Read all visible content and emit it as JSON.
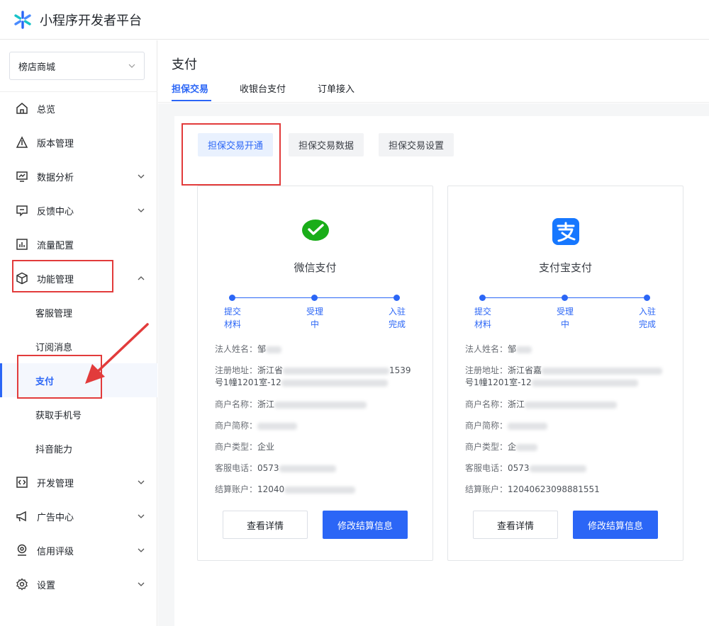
{
  "app": {
    "title": "小程序开发者平台"
  },
  "sidebar": {
    "store": "榜店商城",
    "items": [
      {
        "label": "总览",
        "icon": "home-icon"
      },
      {
        "label": "版本管理",
        "icon": "version-icon"
      },
      {
        "label": "数据分析",
        "icon": "chart-icon"
      },
      {
        "label": "反馈中心",
        "icon": "feedback-icon"
      },
      {
        "label": "流量配置",
        "icon": "traffic-icon"
      },
      {
        "label": "功能管理",
        "icon": "box-icon"
      },
      {
        "label": "开发管理",
        "icon": "code-icon"
      },
      {
        "label": "广告中心",
        "icon": "megaphone-icon"
      },
      {
        "label": "信用评级",
        "icon": "badge-icon"
      },
      {
        "label": "设置",
        "icon": "gear-icon"
      }
    ],
    "subitems": [
      "客服管理",
      "订阅消息",
      "支付",
      "获取手机号",
      "抖音能力"
    ]
  },
  "main": {
    "title": "支付",
    "tabs": [
      "担保交易",
      "收银台支付",
      "订单接入"
    ],
    "subtabs": [
      "担保交易开通",
      "担保交易数据",
      "担保交易设置"
    ]
  },
  "steps": [
    {
      "l1": "提交",
      "l2": "材料"
    },
    {
      "l1": "受理",
      "l2": "中"
    },
    {
      "l1": "入驻",
      "l2": "完成"
    }
  ],
  "labels": {
    "legal_name": "法人姓名：",
    "address": "注册地址：",
    "merchant_name": "商户名称：",
    "short_name": "商户简称：",
    "merchant_type": "商户类型：",
    "phone": "客服电话：",
    "account": "结算账户："
  },
  "cards": {
    "wechat": {
      "name": "微信支付",
      "legal_name": "邹",
      "address_a": "浙江省",
      "address_a2": "1539",
      "address_b": "号1幢1201室-12",
      "merchant_name": "浙江",
      "merchant_type": "企业",
      "phone": "0573",
      "account": "12040"
    },
    "alipay": {
      "name": "支付宝支付",
      "legal_name": "邹",
      "address_a": "浙江省嘉",
      "address_b": "号1幢1201室-12",
      "merchant_name": "浙江",
      "merchant_type": "企",
      "phone": "0573",
      "account": "12040623098881551"
    }
  },
  "buttons": {
    "details": "查看详情",
    "modify": "修改结算信息"
  },
  "colors": {
    "accent": "#2b66f6",
    "wechat": "#1aad19",
    "alipay": "#1677ff",
    "highlight": "#e23b3b"
  }
}
